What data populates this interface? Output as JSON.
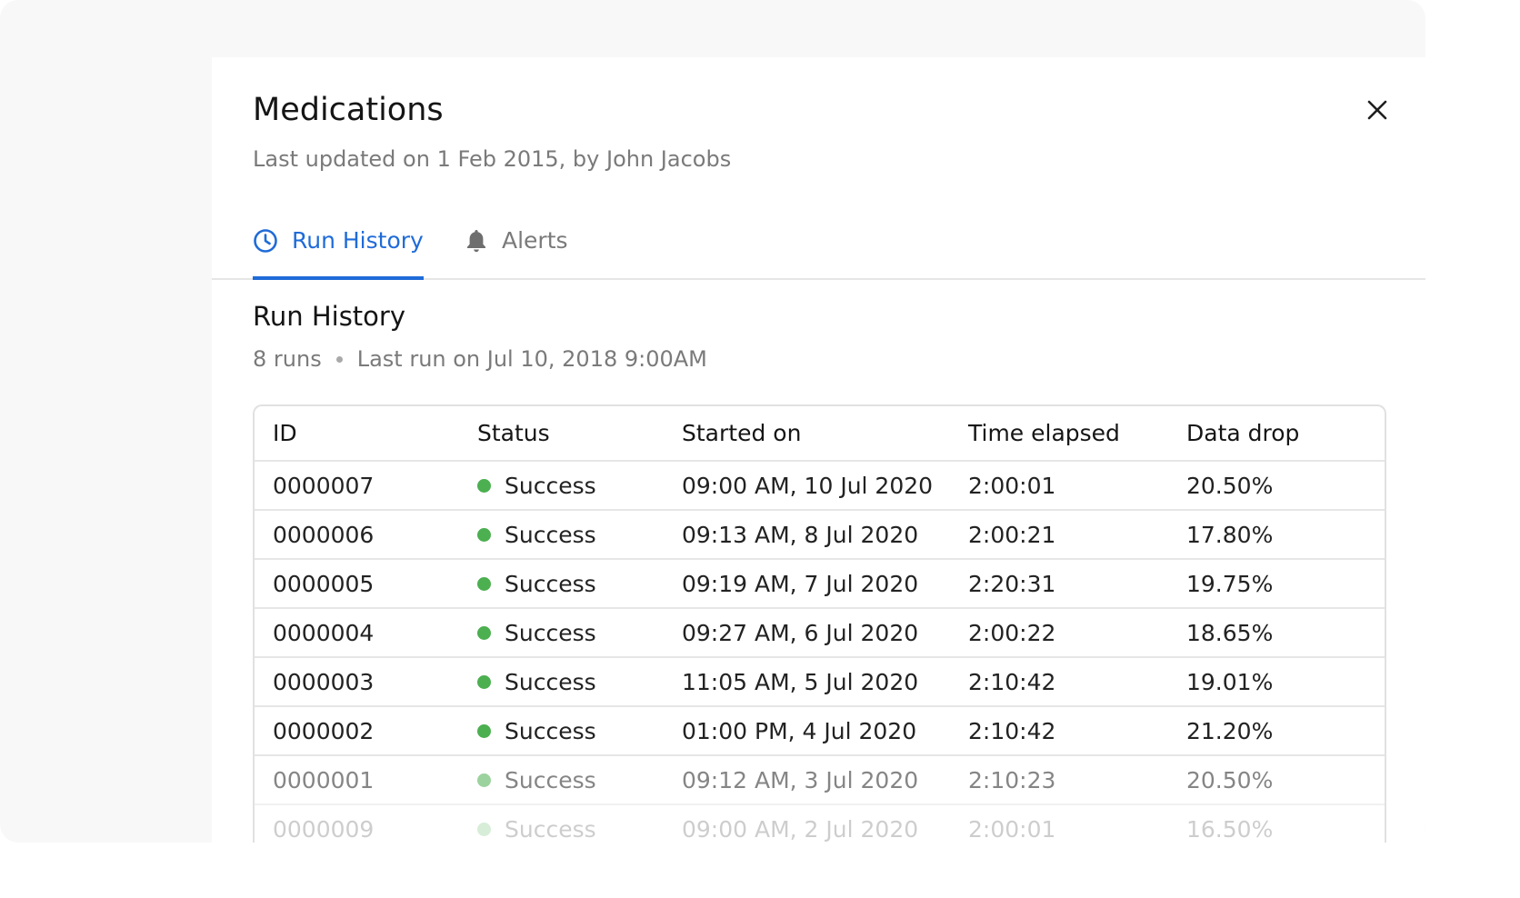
{
  "panel": {
    "title": "Medications",
    "subtitle": "Last updated on 1 Feb 2015, by John Jacobs"
  },
  "tabs": [
    {
      "label": "Run History",
      "icon": "clock-icon",
      "active": true
    },
    {
      "label": "Alerts",
      "icon": "bell-icon",
      "active": false
    }
  ],
  "section": {
    "title": "Run History",
    "runs_count": "8 runs",
    "last_run": "Last run on Jul 10, 2018 9:00AM"
  },
  "table": {
    "headers": [
      "ID",
      "Status",
      "Started on",
      "Time elapsed",
      "Data drop"
    ],
    "rows": [
      {
        "id": "0000007",
        "status": "Success",
        "started": "09:00 AM, 10 Jul 2020",
        "elapsed": "2:00:01",
        "drop": "20.50%"
      },
      {
        "id": "0000006",
        "status": "Success",
        "started": "09:13 AM, 8 Jul 2020",
        "elapsed": "2:00:21",
        "drop": "17.80%"
      },
      {
        "id": "0000005",
        "status": "Success",
        "started": "09:19 AM, 7 Jul 2020",
        "elapsed": "2:20:31",
        "drop": "19.75%"
      },
      {
        "id": "0000004",
        "status": "Success",
        "started": "09:27 AM, 6 Jul 2020",
        "elapsed": "2:00:22",
        "drop": "18.65%"
      },
      {
        "id": "0000003",
        "status": "Success",
        "started": "11:05 AM, 5 Jul 2020",
        "elapsed": "2:10:42",
        "drop": "19.01%"
      },
      {
        "id": "0000002",
        "status": "Success",
        "started": "01:00 PM, 4 Jul 2020",
        "elapsed": "2:10:42",
        "drop": "21.20%"
      },
      {
        "id": "0000001",
        "status": "Success",
        "started": "09:12 AM, 3 Jul 2020",
        "elapsed": "2:10:23",
        "drop": "20.50%"
      },
      {
        "id": "0000009",
        "status": "Success",
        "started": "09:00 AM, 2 Jul 2020",
        "elapsed": "2:00:01",
        "drop": "16.50%"
      }
    ]
  },
  "colors": {
    "accent": "#1f6bd8",
    "success": "#4caf50",
    "muted_text": "#7a7a7a"
  }
}
